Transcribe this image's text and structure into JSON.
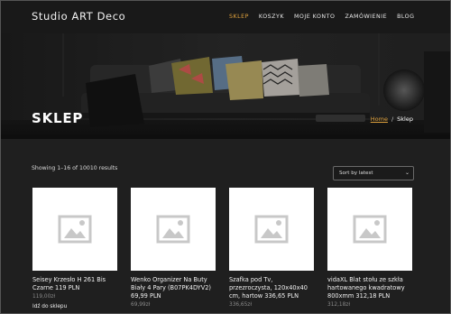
{
  "site": {
    "title": "Studio ART Deco"
  },
  "nav": {
    "items": [
      {
        "label": "SKLEP",
        "active": true
      },
      {
        "label": "KOSZYK",
        "active": false
      },
      {
        "label": "MOJE KONTO",
        "active": false
      },
      {
        "label": "ZAMÓWIENIE",
        "active": false
      },
      {
        "label": "BLOG",
        "active": false
      }
    ]
  },
  "hero": {
    "title": "SKLEP",
    "breadcrumb": {
      "home": "Home",
      "separator": "/",
      "current": "Sklep"
    }
  },
  "shop": {
    "result_count": "Showing 1–16 of 10010 results",
    "sort_selected": "Sort by latest"
  },
  "products": [
    {
      "title": "Seisey Krzesło H 261 Bis Czarne 119 PLN",
      "price": "119,00zł",
      "link": "Idź do sklepu",
      "image": "placeholder-image-icon"
    },
    {
      "title": "Wenko Organizer Na Buty Biały 4 Pary (B07PK4DYV2) 69,99 PLN",
      "price": "69,99zł",
      "link": "",
      "image": "placeholder-image-icon"
    },
    {
      "title": "Szafka pod Tv, przezroczysta, 120x40x40 cm, hartow 336,65 PLN",
      "price": "336,65zł",
      "link": "",
      "image": "placeholder-image-icon"
    },
    {
      "title": "vidaXL Blat stołu ze szkła hartowanego kwadratowy 800xmm 312,18 PLN",
      "price": "312,18zł",
      "link": "",
      "image": "placeholder-image-icon"
    }
  ],
  "colors": {
    "accent": "#e0a23d",
    "background": "#1f1f1f",
    "header": "#191919"
  }
}
